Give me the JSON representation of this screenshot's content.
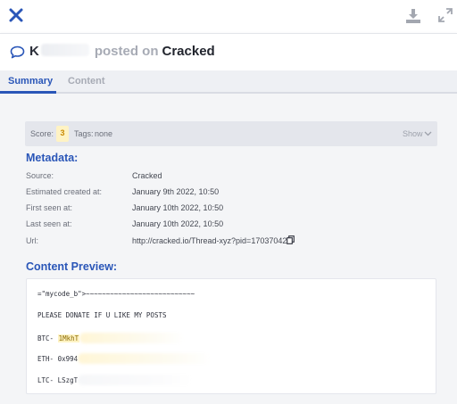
{
  "window": {
    "icons": {
      "close": "close-icon",
      "download": "download-icon",
      "expand": "expand-icon"
    }
  },
  "header": {
    "icon": "chat-bubble-icon",
    "author_initial": "K",
    "posted_label": "posted on",
    "forum": "Cracked"
  },
  "tabs": [
    {
      "label": "Summary",
      "active": true
    },
    {
      "label": "Content",
      "active": false
    }
  ],
  "score_bar": {
    "score_label": "Score:",
    "score_value": "3",
    "tags_label": "Tags:",
    "tags_value": "none",
    "show_label": "Show"
  },
  "metadata": {
    "heading": "Metadata:",
    "rows": [
      {
        "key": "Source:",
        "value": "Cracked"
      },
      {
        "key": "Estimated created at:",
        "value": "January 9th 2022, 10:50"
      },
      {
        "key": "First seen at:",
        "value": "January 10th 2022, 10:50"
      },
      {
        "key": "Last seen at:",
        "value": "January 10th 2022, 10:50"
      },
      {
        "key": "Url:",
        "value": "http://cracked.io/Thread-xyz?pid=17037042"
      }
    ]
  },
  "content_preview": {
    "heading": "Content Preview:",
    "lines": {
      "code": "=\"mycode_b\">~~~~~~~~~~~~~~~~~~~~~~~~~~~",
      "donate": "PLEASE DONATE IF U LIKE MY POSTS",
      "btc_label": "BTC-",
      "btc_prefix": "1MkhT",
      "eth_label": "ETH-",
      "eth_prefix": "0x994",
      "ltc_label": "LTC-",
      "ltc_prefix": "LSzgT"
    }
  },
  "colors": {
    "accent": "#2a56b8",
    "score_badge": "#fff3c4",
    "highlight": "#fff3c4"
  }
}
